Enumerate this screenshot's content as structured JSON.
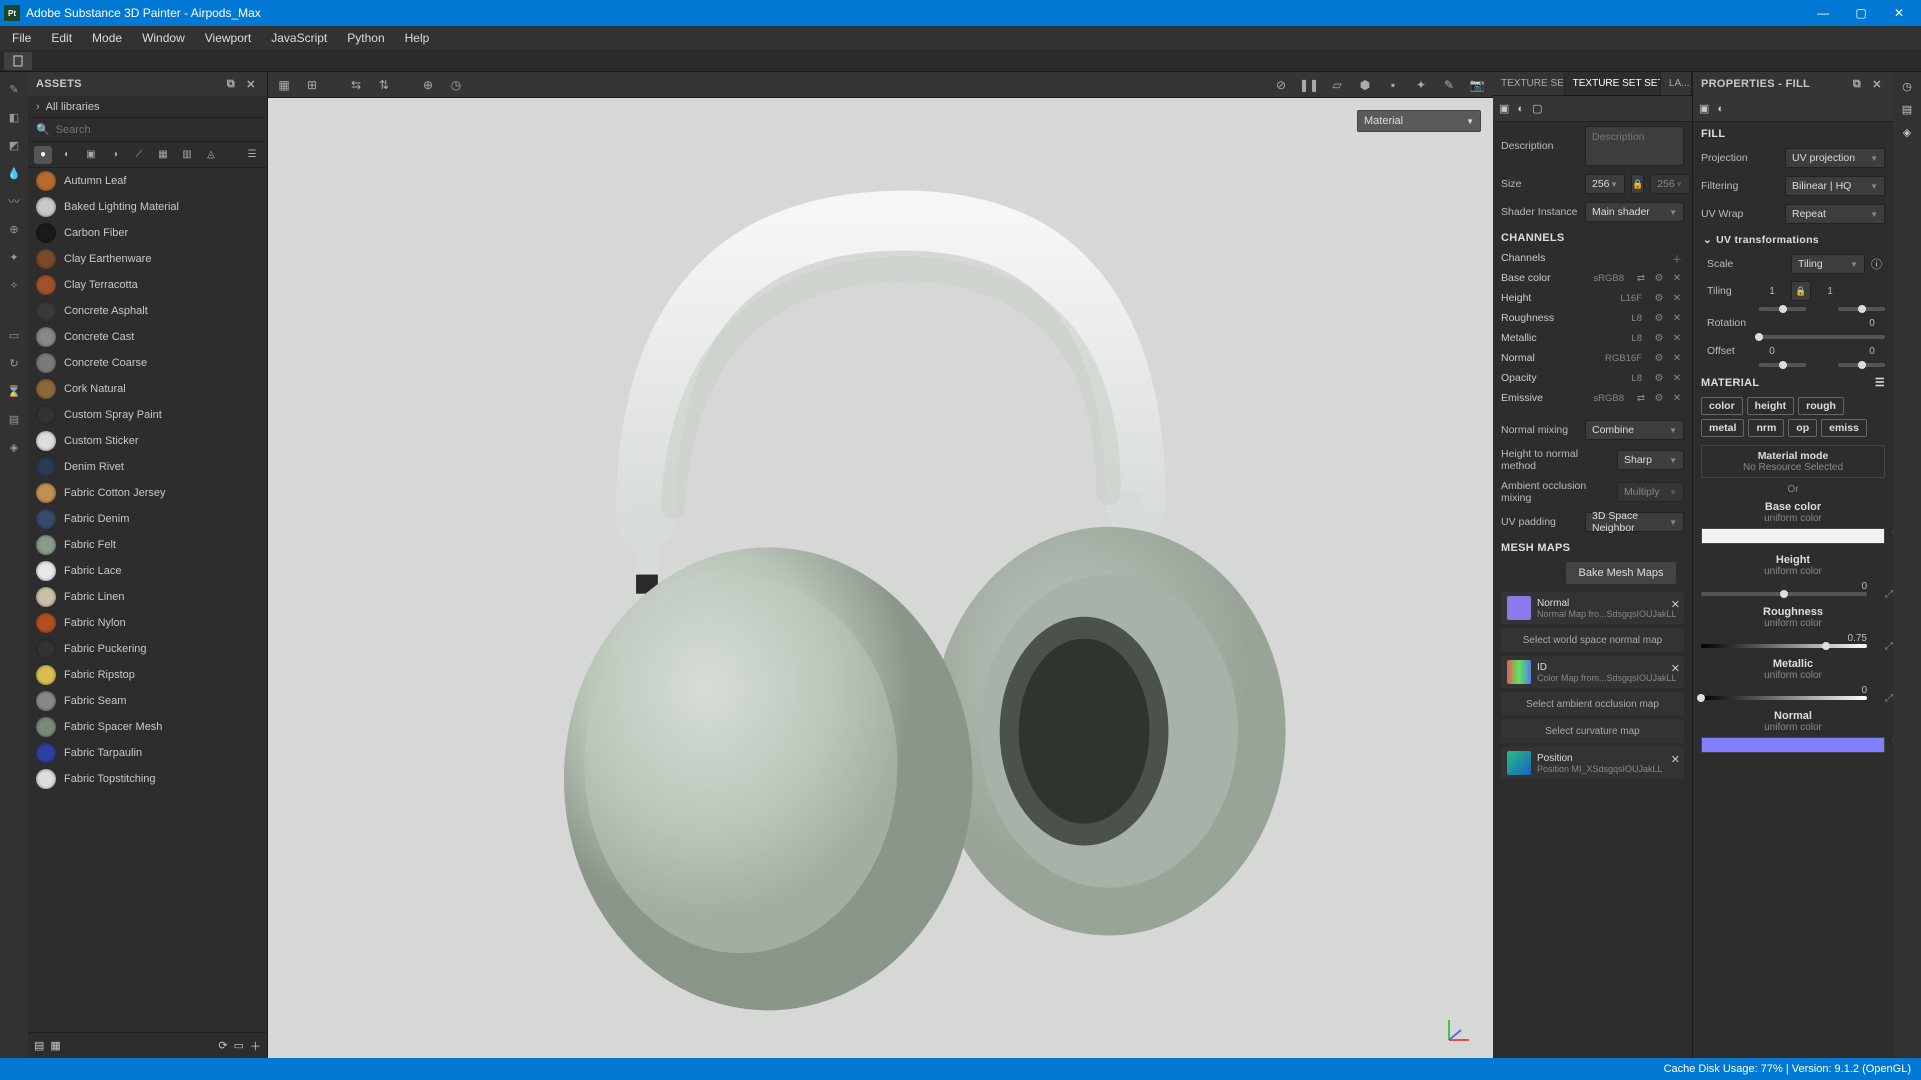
{
  "app": {
    "title": "Adobe Substance 3D Painter - Airpods_Max"
  },
  "menu": [
    "File",
    "Edit",
    "Mode",
    "Window",
    "Viewport",
    "JavaScript",
    "Python",
    "Help"
  ],
  "assets": {
    "title": "ASSETS",
    "breadcrumb": "All libraries",
    "search_ph": "Search",
    "items": [
      {
        "label": "Autumn Leaf",
        "color": "#b86b2d"
      },
      {
        "label": "Baked Lighting Material",
        "color": "#c8c8c8"
      },
      {
        "label": "Carbon Fiber",
        "color": "#1a1a1a"
      },
      {
        "label": "Clay Earthenware",
        "color": "#7a4a2a"
      },
      {
        "label": "Clay Terracotta",
        "color": "#a0522d"
      },
      {
        "label": "Concrete Asphalt",
        "color": "#3a3a3a"
      },
      {
        "label": "Concrete Cast",
        "color": "#888"
      },
      {
        "label": "Concrete Coarse",
        "color": "#7a7a7a"
      },
      {
        "label": "Cork Natural",
        "color": "#8a6a3a"
      },
      {
        "label": "Custom Spray Paint",
        "color": "#333"
      },
      {
        "label": "Custom Sticker",
        "color": "#ddd"
      },
      {
        "label": "Denim Rivet",
        "color": "#2a3a55"
      },
      {
        "label": "Fabric Cotton Jersey",
        "color": "#c09050"
      },
      {
        "label": "Fabric Denim",
        "color": "#3a4a6a"
      },
      {
        "label": "Fabric Felt",
        "color": "#8a9a8a"
      },
      {
        "label": "Fabric Lace",
        "color": "#e8e8e8"
      },
      {
        "label": "Fabric Linen",
        "color": "#c8c0a8"
      },
      {
        "label": "Fabric Nylon",
        "color": "#b05020"
      },
      {
        "label": "Fabric Puckering",
        "color": "#333"
      },
      {
        "label": "Fabric Ripstop",
        "color": "#d8c050"
      },
      {
        "label": "Fabric Seam",
        "color": "#888"
      },
      {
        "label": "Fabric Spacer Mesh",
        "color": "#7a8a7a"
      },
      {
        "label": "Fabric Tarpaulin",
        "color": "#3040a0"
      },
      {
        "label": "Fabric Topstitching",
        "color": "#ddd"
      }
    ]
  },
  "viewport": {
    "material_dd": "Material"
  },
  "tabs": [
    {
      "label": "TEXTURE SET ...",
      "active": false
    },
    {
      "label": "TEXTURE SET SETT...",
      "active": true,
      "close": true
    },
    {
      "label": "LA...",
      "active": false
    }
  ],
  "texset": {
    "desc_label": "Description",
    "desc_ph": "Description",
    "size_label": "Size",
    "size_val": "256",
    "size_locked": "256",
    "shader_label": "Shader Instance",
    "shader_val": "Main shader",
    "channels_title": "CHANNELS",
    "channels_label": "Channels",
    "channels": [
      {
        "name": "Base color",
        "fmt": "sRGB8",
        "extra": true
      },
      {
        "name": "Height",
        "fmt": "L16F"
      },
      {
        "name": "Roughness",
        "fmt": "L8"
      },
      {
        "name": "Metallic",
        "fmt": "L8"
      },
      {
        "name": "Normal",
        "fmt": "RGB16F"
      },
      {
        "name": "Opacity",
        "fmt": "L8"
      },
      {
        "name": "Emissive",
        "fmt": "sRGB8",
        "extra": true
      }
    ],
    "nmix_label": "Normal mixing",
    "nmix": "Combine",
    "h2n_label": "Height to normal method",
    "h2n": "Sharp",
    "ao_label": "Ambient occlusion mixing",
    "ao": "Multiply",
    "uvp_label": "UV padding",
    "uvp": "3D Space Neighbor",
    "mesh_title": "MESH MAPS",
    "bake": "Bake Mesh Maps",
    "maps": [
      {
        "t": "Normal",
        "s": "Normal Map fro...SdsgqsIOUJakLL",
        "thumb": "#8a7ae8"
      },
      {
        "sel": "Select world space normal map"
      },
      {
        "t": "ID",
        "s": "Color Map from...SdsgqsIOUJakLL",
        "thumb": "linear-gradient(90deg,#e85a5a,#5ae85a,#5a7ae8)"
      },
      {
        "sel": "Select ambient occlusion map"
      },
      {
        "sel": "Select curvature map"
      },
      {
        "t": "Position",
        "s": "Position MI_XSdsgqsIOUJakLL",
        "thumb": "linear-gradient(135deg,#20c080,#2060c0)"
      }
    ]
  },
  "props": {
    "title": "PROPERTIES - FILL",
    "fill_title": "FILL",
    "proj_label": "Projection",
    "proj": "UV projection",
    "filt_label": "Filtering",
    "filt": "Bilinear | HQ",
    "wrap_label": "UV Wrap",
    "wrap": "Repeat",
    "uvtr_title": "UV transformations",
    "scale_label": "Scale",
    "scale": "Tiling",
    "tiling_label": "Tiling",
    "tiling_a": "1",
    "tiling_b": "1",
    "rot_label": "Rotation",
    "rot": "0",
    "off_label": "Offset",
    "off_a": "0",
    "off_b": "0",
    "mat_title": "MATERIAL",
    "chips": [
      "color",
      "height",
      "rough",
      "metal",
      "nrm",
      "op",
      "emiss"
    ],
    "mmode": "Material mode",
    "mmode_s": "No Resource Selected",
    "or": "Or",
    "sects": [
      {
        "t": "Base color",
        "s": "uniform color",
        "swatch": "#f2f2f2"
      },
      {
        "t": "Height",
        "s": "uniform color",
        "val": "0",
        "pos": 50
      },
      {
        "t": "Roughness",
        "s": "uniform color",
        "val": "0.75",
        "pos": 75,
        "grad": "linear-gradient(90deg,#000,#fff)"
      },
      {
        "t": "Metallic",
        "s": "uniform color",
        "val": "0",
        "pos": 0,
        "grad": "linear-gradient(90deg,#000,#fff)"
      },
      {
        "t": "Normal",
        "s": "uniform color",
        "swatch": "#8080ff"
      }
    ]
  },
  "status": "Cache Disk Usage:   77% | Version: 9.1.2 (OpenGL)"
}
